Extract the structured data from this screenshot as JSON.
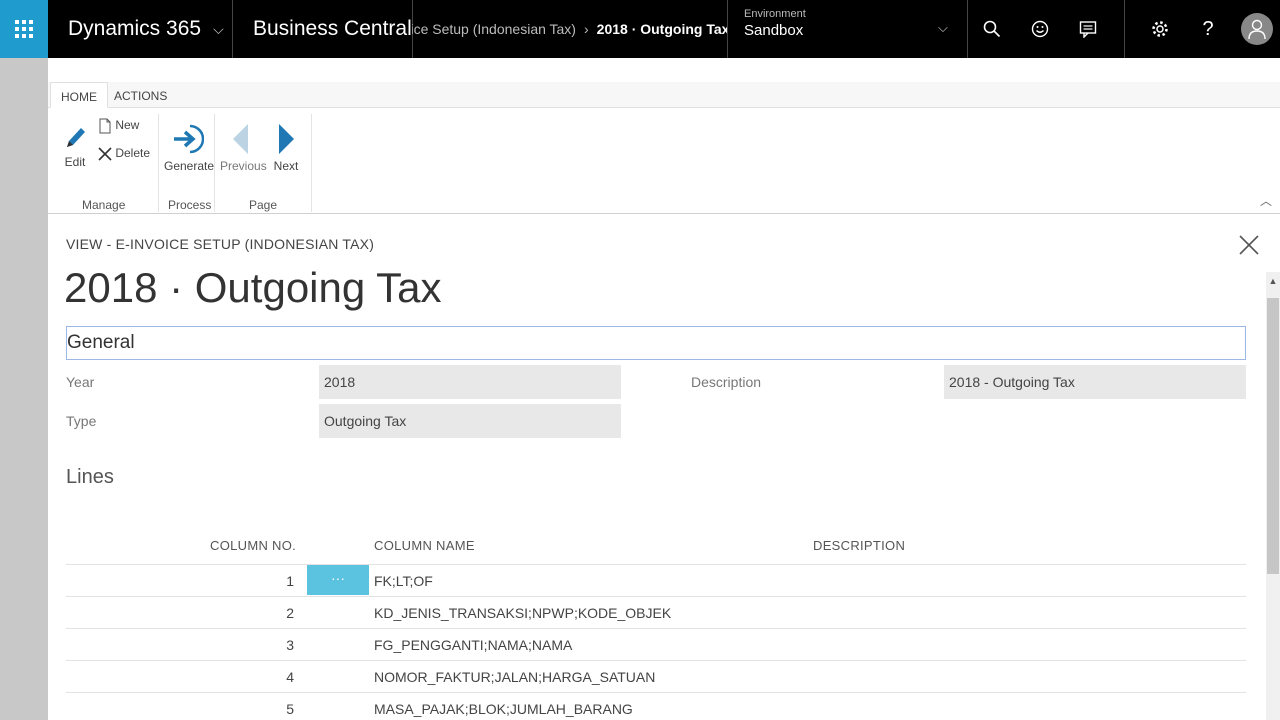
{
  "topbar": {
    "product": "Dynamics 365",
    "app": "Business Central",
    "breadcrumb_parent": "E-Invoice Setup (Indonesian Tax)",
    "breadcrumb_current": "2018 · Outgoing Tax",
    "env_label": "Environment",
    "env_value": "Sandbox"
  },
  "ribbon": {
    "tabs": [
      "HOME",
      "ACTIONS"
    ],
    "edit": "Edit",
    "new": "New",
    "delete": "Delete",
    "generate": "Generate",
    "previous": "Previous",
    "next": "Next",
    "groups": [
      "Manage",
      "Process",
      "Page"
    ]
  },
  "page": {
    "caption": "VIEW - E-INVOICE SETUP (INDONESIAN TAX)",
    "title": "2018 · Outgoing Tax",
    "section_general": "General",
    "fields": {
      "year_label": "Year",
      "year_value": "2018",
      "type_label": "Type",
      "type_value": "Outgoing Tax",
      "description_label": "Description",
      "description_value": "2018 - Outgoing Tax"
    },
    "lines_title": "Lines",
    "columns": [
      "COLUMN NO.",
      "COLUMN NAME",
      "DESCRIPTION"
    ],
    "more_glyph": "···",
    "rows": [
      {
        "no": "1",
        "name": "FK;LT;OF"
      },
      {
        "no": "2",
        "name": "KD_JENIS_TRANSAKSI;NPWP;KODE_OBJEK"
      },
      {
        "no": "3",
        "name": "FG_PENGGANTI;NAMA;NAMA"
      },
      {
        "no": "4",
        "name": "NOMOR_FAKTUR;JALAN;HARGA_SATUAN"
      },
      {
        "no": "5",
        "name": "MASA_PAJAK;BLOK;JUMLAH_BARANG"
      }
    ]
  },
  "colors": {
    "waffle": "#1f9bce",
    "accent_cell": "#5bc3df",
    "topbar": "#000000"
  }
}
